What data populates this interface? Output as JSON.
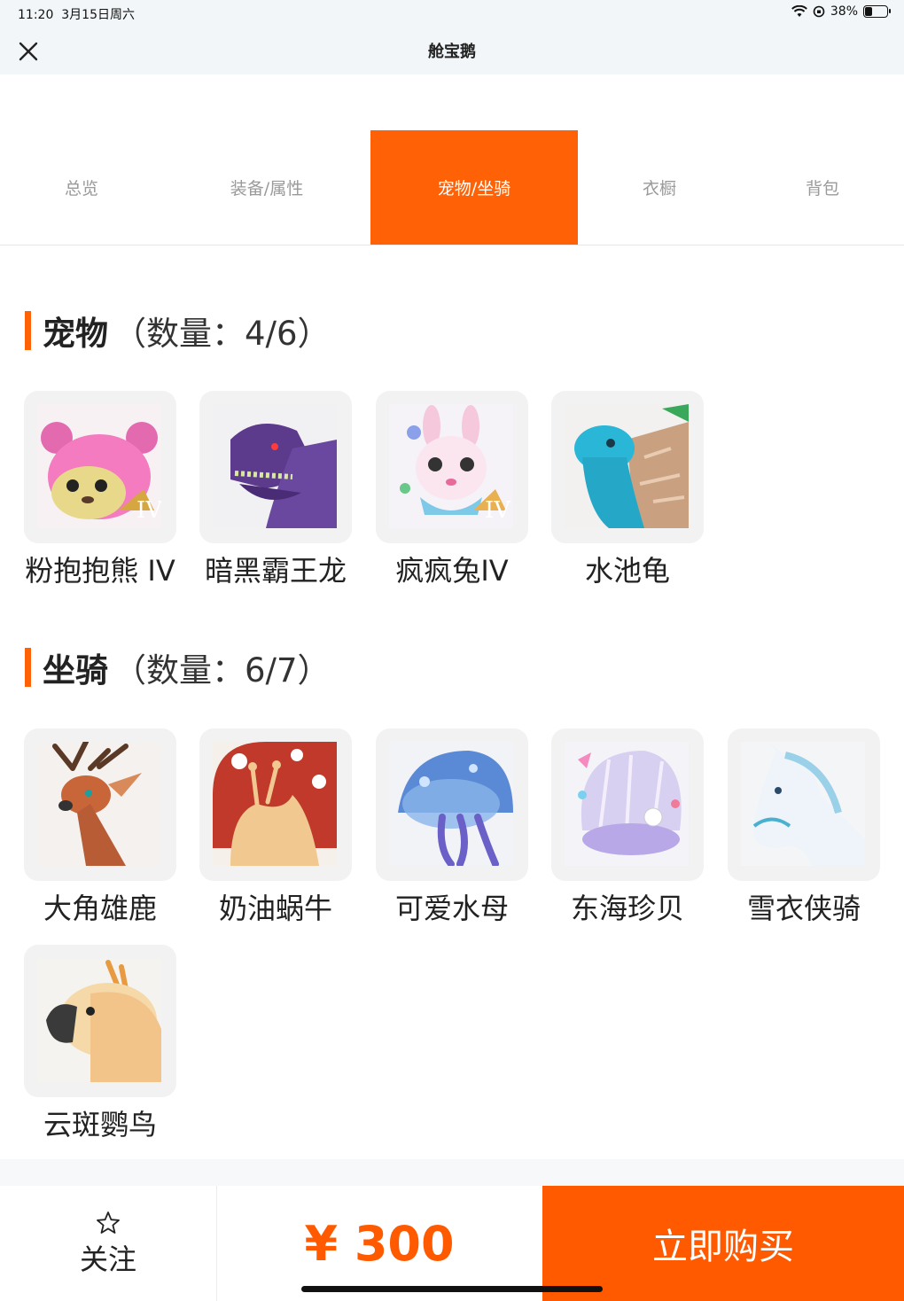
{
  "status": {
    "time": "11:20",
    "date": "3月15日周六",
    "battery": "38%",
    "battery_level": 0.38
  },
  "nav": {
    "title": "舱宝鹅",
    "close_icon": "close-icon"
  },
  "tabs": [
    {
      "label": "总览",
      "active": false
    },
    {
      "label": "装备/属性",
      "active": false
    },
    {
      "label": "宠物/坐骑",
      "active": true
    },
    {
      "label": "衣橱",
      "active": false
    },
    {
      "label": "背包",
      "active": false
    }
  ],
  "pets": {
    "title": "宠物",
    "count": "（数量：4/6）",
    "items": [
      {
        "name": "粉抱抱熊 IV",
        "icon": "pink-bear-pet-icon"
      },
      {
        "name": "暗黑霸王龙",
        "icon": "dark-trex-pet-icon"
      },
      {
        "name": "疯疯兔IV",
        "icon": "crazy-rabbit-pet-icon"
      },
      {
        "name": "水池龟",
        "icon": "pond-turtle-pet-icon"
      }
    ]
  },
  "mounts": {
    "title": "坐骑",
    "count": "（数量：6/7）",
    "items": [
      {
        "name": "大角雄鹿",
        "icon": "antlered-stag-mount-icon"
      },
      {
        "name": "奶油蜗牛",
        "icon": "cream-snail-mount-icon"
      },
      {
        "name": "可爱水母",
        "icon": "cute-jellyfish-mount-icon"
      },
      {
        "name": "东海珍贝",
        "icon": "pearl-shell-mount-icon"
      },
      {
        "name": "雪衣侠骑",
        "icon": "snow-horse-mount-icon"
      },
      {
        "name": "云斑鹦鸟",
        "icon": "cloud-parrot-mount-icon"
      }
    ]
  },
  "bottom": {
    "follow_label": "关注",
    "follow_icon": "star-outline-icon",
    "price": "¥ 300",
    "buy_label": "立即购买"
  },
  "colors": {
    "accent": "#ff6206",
    "buy_bg": "#ff5a00"
  }
}
